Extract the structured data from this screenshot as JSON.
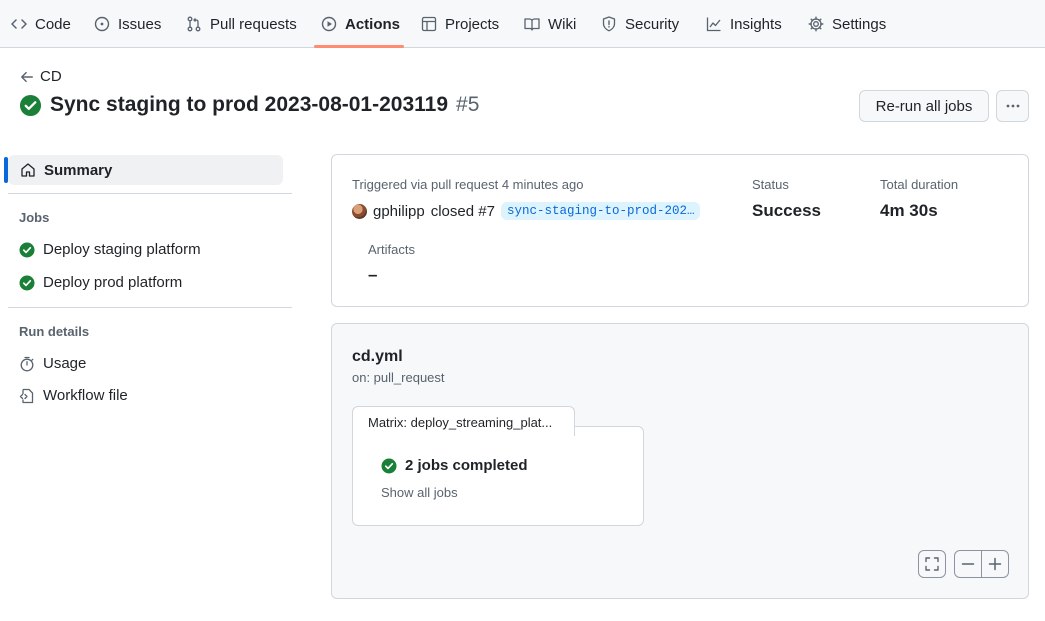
{
  "nav": {
    "code": "Code",
    "issues": "Issues",
    "pull_requests": "Pull requests",
    "actions": "Actions",
    "projects": "Projects",
    "wiki": "Wiki",
    "security": "Security",
    "insights": "Insights",
    "settings": "Settings",
    "active_tab": "Actions"
  },
  "header": {
    "back_label": "CD",
    "run_title": "Sync staging to prod 2023-08-01-203119",
    "run_number": "#5",
    "rerun_label": "Re-run all jobs",
    "more_label": "···",
    "status_color": "#1a7f37"
  },
  "sidebar": {
    "summary_label": "Summary",
    "jobs_heading": "Jobs",
    "jobs": [
      {
        "label": "Deploy staging platform",
        "status": "success"
      },
      {
        "label": "Deploy prod platform",
        "status": "success"
      }
    ],
    "run_details_heading": "Run details",
    "usage_label": "Usage",
    "workflow_file_label": "Workflow file"
  },
  "summary": {
    "trigger_text": "Triggered via pull request 4 minutes ago",
    "actor": "gphilipp",
    "action_text": "closed #7",
    "branch": "sync-staging-to-prod-202…",
    "status_label": "Status",
    "status_value": "Success",
    "duration_label": "Total duration",
    "duration_value": "4m 30s",
    "artifacts_label": "Artifacts",
    "artifacts_value": "–"
  },
  "workflow": {
    "file": "cd.yml",
    "trigger": "on: pull_request",
    "matrix_label": "Matrix: deploy_streaming_plat...",
    "jobs_completed": "2 jobs completed",
    "show_all": "Show all jobs"
  },
  "controls": {
    "fullscreen_icon": "fullscreen-icon",
    "zoom_out_icon": "minus-icon",
    "zoom_in_icon": "plus-icon"
  },
  "colors": {
    "accent": "#0969da",
    "success": "#1a7f37",
    "active_underline": "#fd8c73"
  }
}
